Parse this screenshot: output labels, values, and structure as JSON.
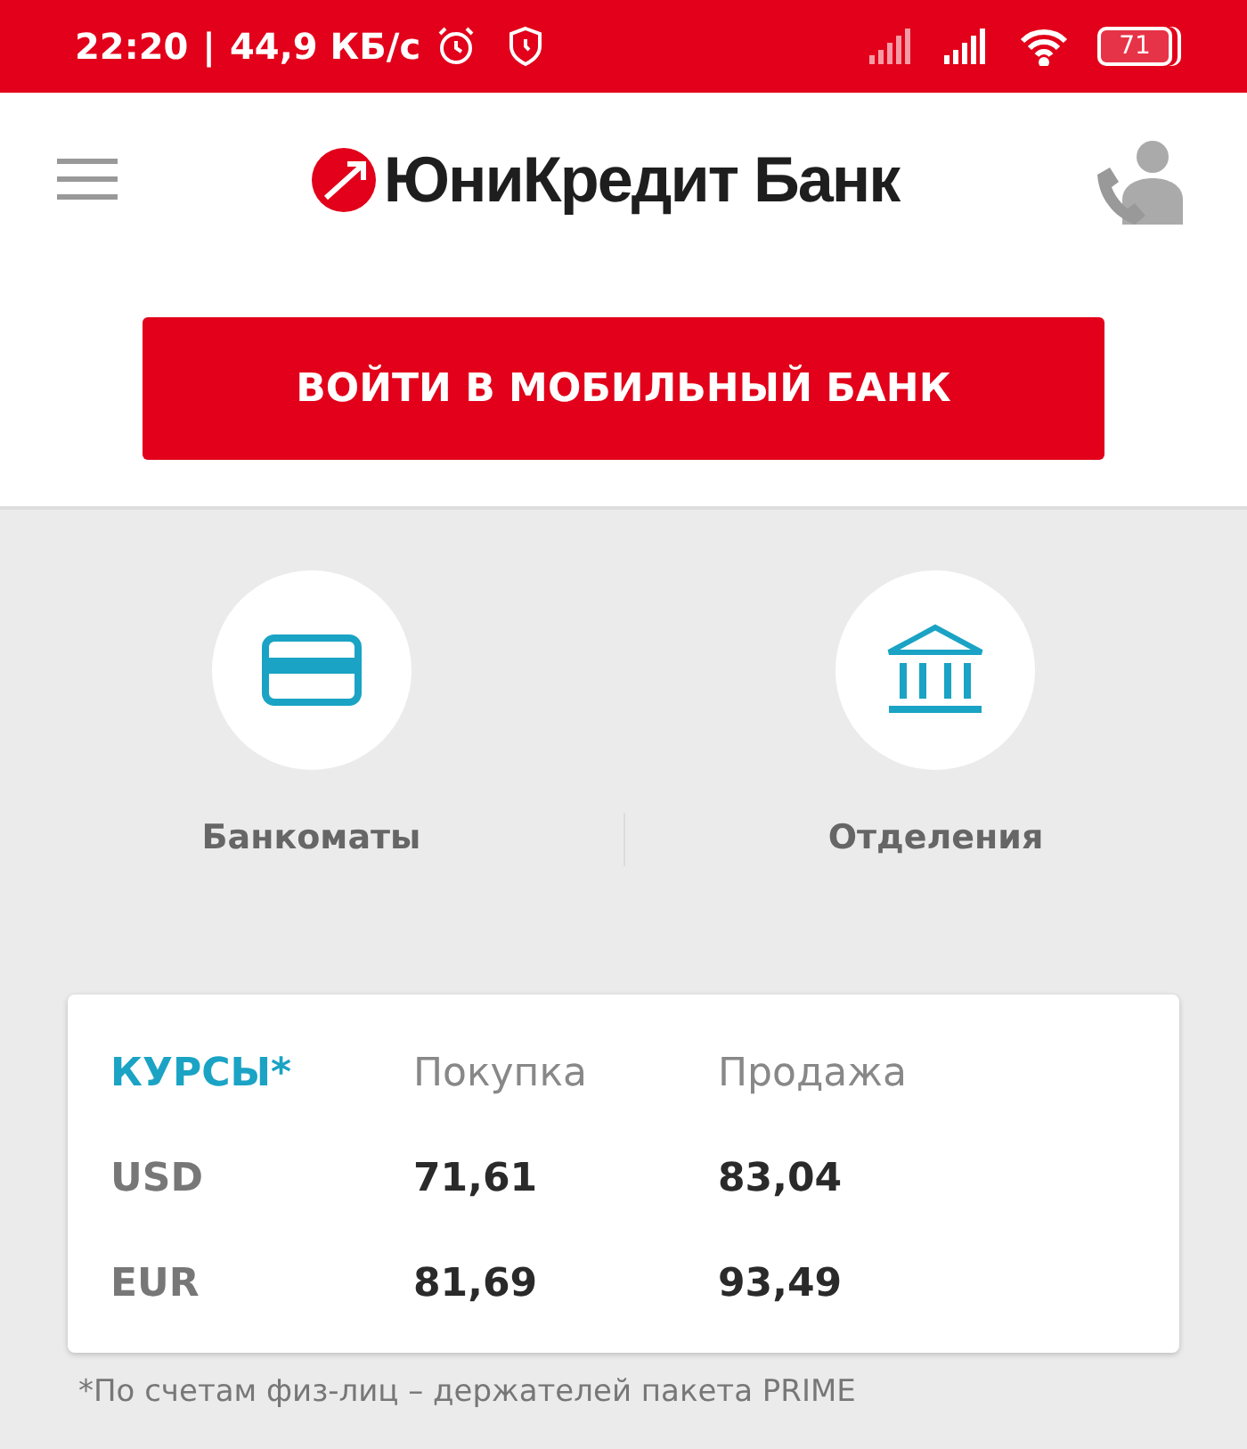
{
  "status_bar": {
    "time": "22:20",
    "separator": "|",
    "speed": "44,9 КБ/с",
    "battery": "71"
  },
  "header": {
    "logo": "ЮниКредит Банк"
  },
  "login_button": "ВОЙТИ В МОБИЛЬНЫЙ БАНК",
  "shortcuts": [
    {
      "kind": "card",
      "label": "Банкоматы"
    },
    {
      "kind": "bank",
      "label": "Отделения"
    }
  ],
  "rates": {
    "title": "КУРСЫ*",
    "columns": [
      "Покупка",
      "Продажа"
    ],
    "rows": [
      {
        "currency": "USD",
        "buy": "71,61",
        "sell": "83,04"
      },
      {
        "currency": "EUR",
        "buy": "81,69",
        "sell": "93,49"
      }
    ],
    "footnote": "*По счетам физ-лиц – держателей пакета PRIME"
  }
}
